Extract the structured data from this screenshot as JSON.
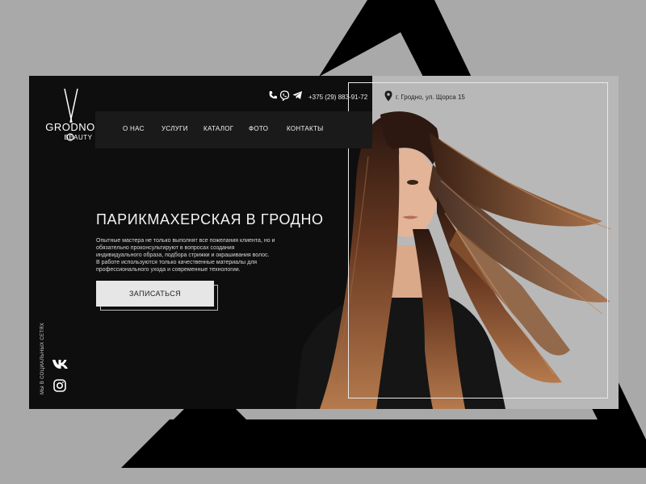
{
  "logo": {
    "word1": "GRODNO",
    "word2": "BEAUTY"
  },
  "nav": {
    "items": [
      {
        "label": "О НАС"
      },
      {
        "label": "УСЛУГИ"
      },
      {
        "label": "КАТАЛОГ"
      },
      {
        "label": "ФОТО"
      },
      {
        "label": "КОНТАКТЫ"
      }
    ]
  },
  "contact": {
    "icons": [
      "phone-icon",
      "viber-icon",
      "telegram-icon"
    ],
    "phone": "+375 (29) 883-91-72",
    "address_icon": "location-pin-icon",
    "address": "г. Гродно, ул. Щорса 15"
  },
  "hero": {
    "title": "ПАРИКМАХЕРСКАЯ В ГРОДНО",
    "text_lines": [
      "Опытные мастера не только выполнят все пожелания клиента, но и",
      "обязательно проконсультируют в вопросах создания",
      "индивидуального образа, подбора стрижки и окрашивания волос.",
      "В работе используются только качественные материалы для",
      "профессионального ухода и современные технологии."
    ],
    "cta_label": "ЗАПИСАТЬСЯ"
  },
  "social": {
    "label": "МЫ В СОЦИАЛЬНЫХ СЕТЯХ",
    "icons": [
      "vk-icon",
      "instagram-icon"
    ]
  },
  "colors": {
    "page_bg": "#a9a9a9",
    "panel_bg": "#0e0e0e",
    "navbar_bg": "#1a1a1a",
    "photo_bg": "#b8b8b8",
    "button_bg": "#e6e6e6"
  }
}
